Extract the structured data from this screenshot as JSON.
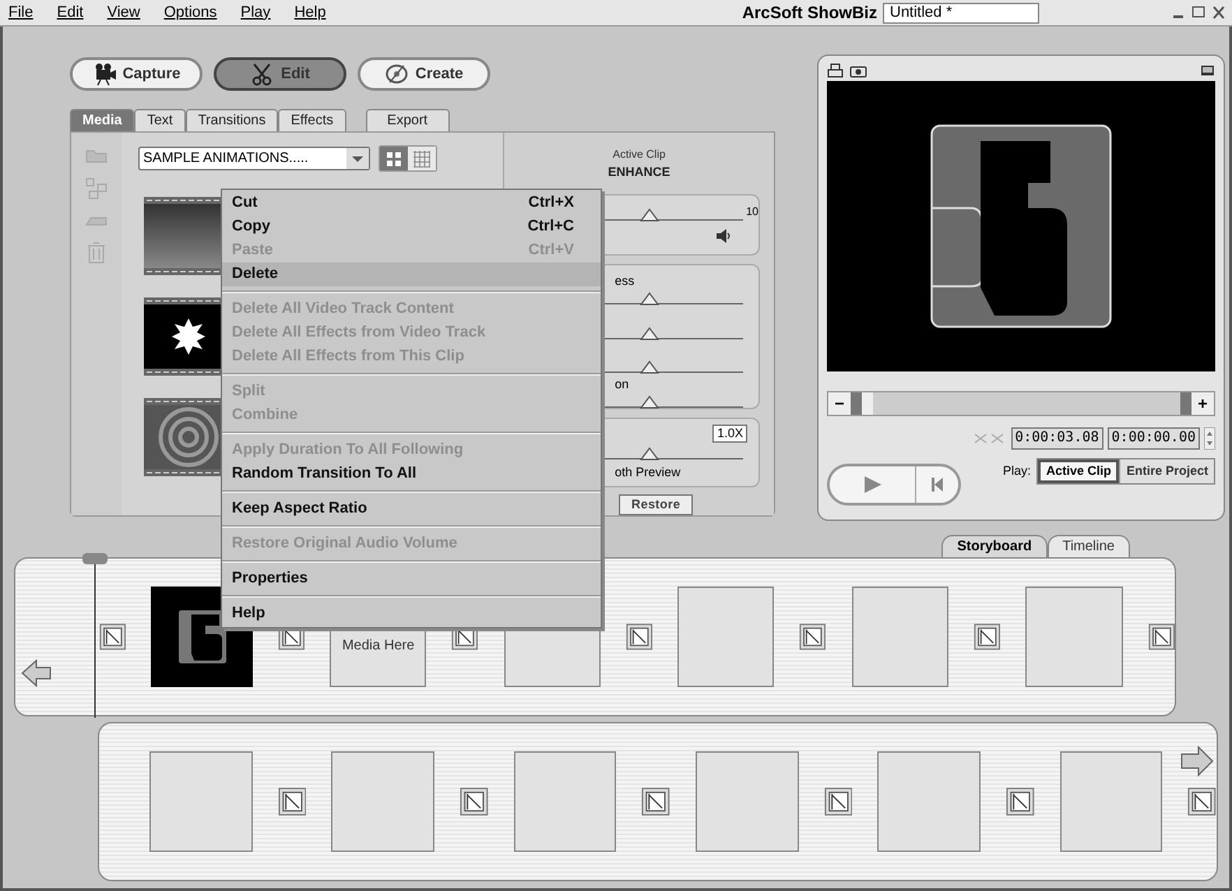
{
  "menubar": [
    "File",
    "Edit",
    "View",
    "Options",
    "Play",
    "Help"
  ],
  "window": {
    "app_name": "ArcSoft ShowBiz",
    "document": "Untitled *"
  },
  "modes": [
    {
      "label": "Capture",
      "selected": false
    },
    {
      "label": "Edit",
      "selected": true
    },
    {
      "label": "Create",
      "selected": false
    }
  ],
  "tabs": [
    {
      "label": "Media",
      "selected": true
    },
    {
      "label": "Text",
      "selected": false
    },
    {
      "label": "Transitions",
      "selected": false
    },
    {
      "label": "Effects",
      "selected": false
    },
    {
      "label": "Export",
      "selected": false
    }
  ],
  "media": {
    "folder": "SAMPLE ANIMATIONS.....",
    "view_modes": [
      {
        "kind": "large",
        "selected": true
      },
      {
        "kind": "small",
        "selected": false
      }
    ],
    "thumbnails": [
      {
        "kind": "gradient"
      },
      {
        "kind": "burst"
      },
      {
        "kind": "spiral"
      }
    ]
  },
  "enhance": {
    "heading": "Active Clip",
    "title": "ENHANCE",
    "volume": {
      "level": 0.55,
      "max": "10"
    },
    "adjustments": [
      {
        "label": "ess",
        "level": 0.55
      },
      {
        "level": 0.55
      },
      {
        "level": 0.55
      },
      {
        "label": "on",
        "level": 0.55
      }
    ],
    "speed": {
      "value": "1.0X",
      "level": 0.55,
      "option": "oth Preview"
    },
    "restore": "Restore"
  },
  "context_menu": [
    [
      {
        "label": "Cut",
        "shortcut": "Ctrl+X",
        "disabled": false,
        "selected": false
      },
      {
        "label": "Copy",
        "shortcut": "Ctrl+C",
        "disabled": false,
        "selected": false
      },
      {
        "label": "Paste",
        "shortcut": "Ctrl+V",
        "disabled": true,
        "selected": false
      },
      {
        "label": "Delete",
        "disabled": false,
        "selected": true
      }
    ],
    [
      {
        "label": "Delete All Video Track Content",
        "disabled": true,
        "selected": false
      },
      {
        "label": "Delete All Effects from Video Track",
        "disabled": true,
        "selected": false
      },
      {
        "label": "Delete All Effects from This Clip",
        "disabled": true,
        "selected": false
      }
    ],
    [
      {
        "label": "Split",
        "disabled": true,
        "selected": false
      },
      {
        "label": "Combine",
        "disabled": true,
        "selected": false
      }
    ],
    [
      {
        "label": "Apply Duration To All Following",
        "disabled": true,
        "selected": false
      },
      {
        "label": "Random Transition To All",
        "disabled": false,
        "selected": false
      }
    ],
    [
      {
        "label": "Keep Aspect Ratio",
        "disabled": false,
        "selected": false
      }
    ],
    [
      {
        "label": "Restore Original Audio Volume",
        "disabled": true,
        "selected": false
      }
    ],
    [
      {
        "label": "Properties",
        "disabled": false,
        "selected": false
      }
    ],
    [
      {
        "label": "Help",
        "disabled": false,
        "selected": false
      }
    ]
  ],
  "preview": {
    "zoom_out": "−",
    "zoom_in": "+",
    "time_current": "0:00:03.08",
    "time_offset": "0:00:00.00",
    "play_label": "Play:",
    "play_modes": [
      {
        "label": "Active Clip",
        "selected": true
      },
      {
        "label": "Entire Project",
        "selected": false
      }
    ]
  },
  "view_tabs": [
    {
      "label": "Storyboard",
      "selected": true
    },
    {
      "label": "Timeline",
      "selected": false
    }
  ],
  "storyboard": [
    [
      {
        "kind": "clip"
      },
      {
        "kind": "drop",
        "text": "Media Here"
      },
      {
        "kind": "empty"
      },
      {
        "kind": "empty"
      },
      {
        "kind": "empty"
      },
      {
        "kind": "empty"
      }
    ],
    [
      {
        "kind": "empty"
      },
      {
        "kind": "empty"
      },
      {
        "kind": "empty"
      },
      {
        "kind": "empty"
      },
      {
        "kind": "empty"
      },
      {
        "kind": "empty"
      }
    ]
  ]
}
